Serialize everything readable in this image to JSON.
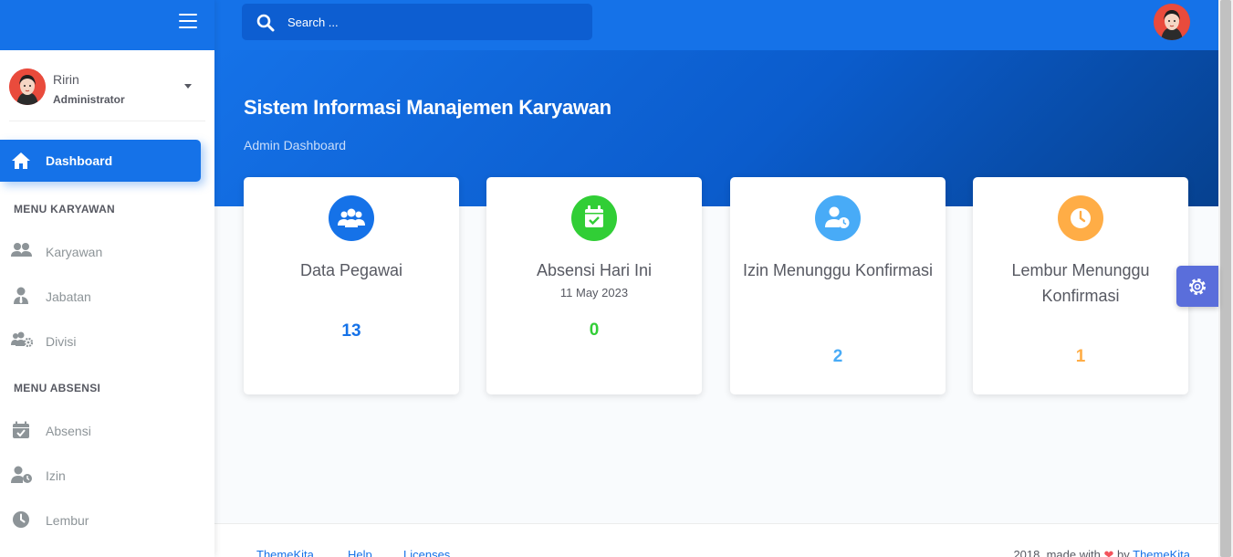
{
  "sidebar": {
    "user": {
      "name": "Ririn",
      "role": "Administrator"
    },
    "active_item": {
      "label": "Dashboard",
      "icon": "home-icon"
    },
    "sections": [
      {
        "title": "MENU KARYAWAN",
        "items": [
          {
            "label": "Karyawan",
            "icon": "users-icon"
          },
          {
            "label": "Jabatan",
            "icon": "user-tie-icon"
          },
          {
            "label": "Divisi",
            "icon": "users-cog-icon"
          }
        ]
      },
      {
        "title": "MENU ABSENSI",
        "items": [
          {
            "label": "Absensi",
            "icon": "calendar-check-icon"
          },
          {
            "label": "Izin",
            "icon": "user-clock-icon"
          },
          {
            "label": "Lembur",
            "icon": "clock-icon"
          }
        ]
      }
    ]
  },
  "header": {
    "search_placeholder": "Search ..."
  },
  "banner": {
    "title": "Sistem Informasi Manajemen Karyawan",
    "subtitle": "Admin Dashboard"
  },
  "cards": [
    {
      "title": "Data Pegawai",
      "value": "13",
      "color": "#1572e8",
      "icon": "users-icon"
    },
    {
      "title": "Absensi Hari Ini",
      "subtitle": "11 May 2023",
      "value": "0",
      "color": "#31ce36",
      "icon": "calendar-check-icon"
    },
    {
      "title": "Izin Menunggu Konfirmasi",
      "value": "2",
      "color": "#48abf7",
      "icon": "user-clock-icon"
    },
    {
      "title": "Lembur Menunggu Konfirmasi",
      "value": "1",
      "color": "#ffad46",
      "icon": "clock-icon"
    }
  ],
  "footer": {
    "links": [
      "ThemeKita",
      "Help",
      "Licenses"
    ],
    "credit_prefix": "2018, made with",
    "credit_by": "by",
    "credit_link": "ThemeKita"
  },
  "colors": {
    "primary": "#1572e8",
    "success": "#31ce36",
    "info": "#48abf7",
    "warning": "#ffad46",
    "settings": "#5a6edb"
  }
}
